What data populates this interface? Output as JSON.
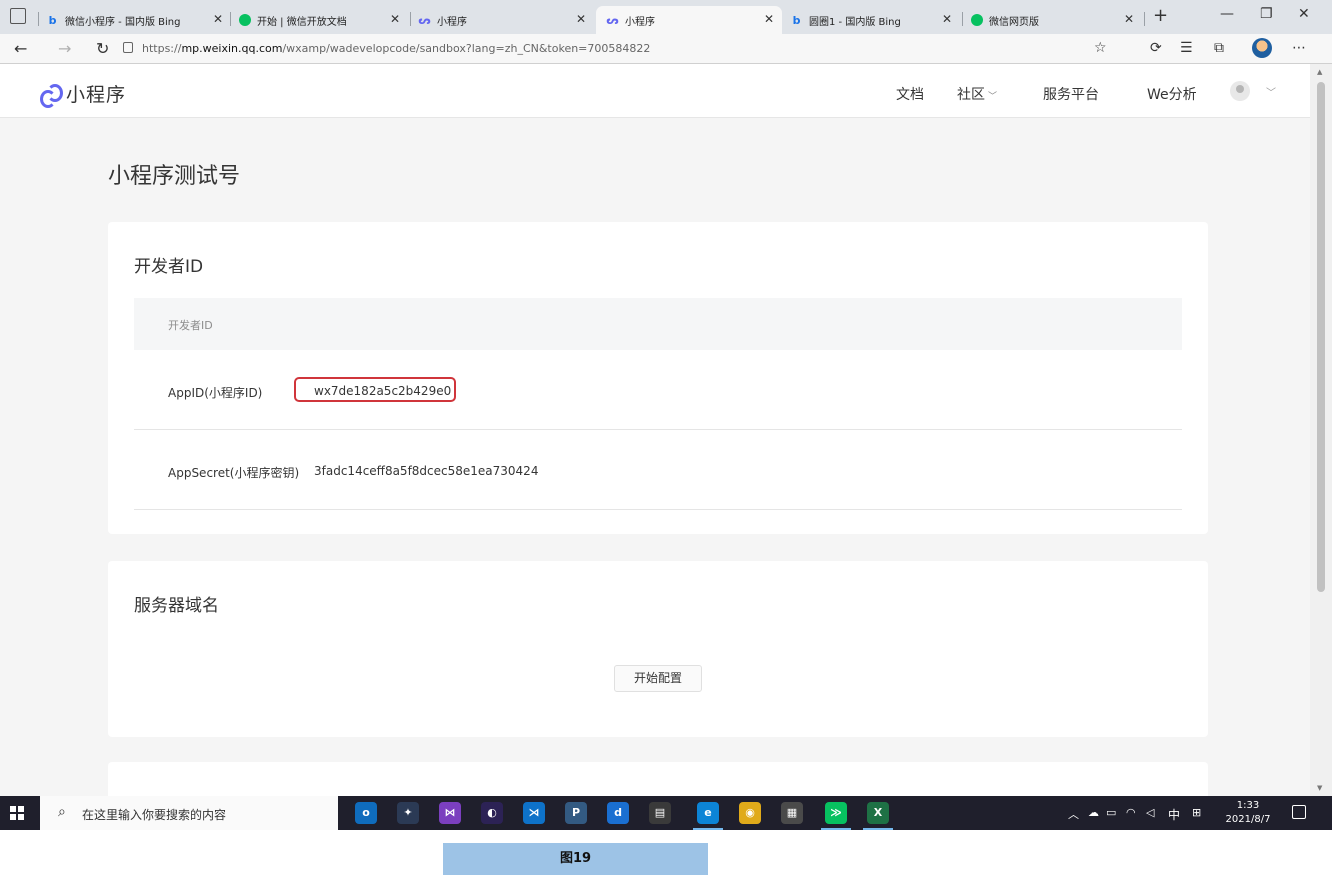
{
  "browser": {
    "tabs": [
      {
        "title": "微信小程序 - 国内版 Bing",
        "icon": "bing-icon"
      },
      {
        "title": "开始 | 微信开放文档",
        "icon": "wechat-icon"
      },
      {
        "title": "小程序",
        "icon": "miniprogram-icon"
      },
      {
        "title": "小程序",
        "icon": "miniprogram-icon"
      },
      {
        "title": "圆圈1 - 国内版 Bing",
        "icon": "bing-icon"
      },
      {
        "title": "微信网页版",
        "icon": "wechat-icon"
      }
    ],
    "active_tab": 3,
    "url_prefix": "https://",
    "url_host": "mp.weixin.qq.com",
    "url_path": "/wxamp/wadevelopcode/sandbox?lang=zh_CN&token=700584822"
  },
  "site": {
    "logo_text": "小程序",
    "nav": {
      "docs": "文档",
      "community": "社区",
      "service": "服务平台",
      "analytics": "We分析"
    }
  },
  "page": {
    "title": "小程序测试号",
    "developer_card": {
      "title": "开发者ID",
      "table_header": "开发者ID",
      "appid_label": "AppID(小程序ID)",
      "appid_value": "wx7de182a5c2b429e0",
      "appsecret_label": "AppSecret(小程序密钥)",
      "appsecret_value": "3fadc14ceff8a5f8dcec58e1ea730424"
    },
    "server_card": {
      "title": "服务器域名",
      "configure_button": "开始配置"
    },
    "accent_color": "#6467f0",
    "highlight_color": "#d0353b"
  },
  "taskbar": {
    "search_placeholder": "在这里输入你要搜索的内容",
    "ime": "中",
    "clock_time": "1:33",
    "clock_date": "2021/8/7"
  },
  "caption": "图19"
}
